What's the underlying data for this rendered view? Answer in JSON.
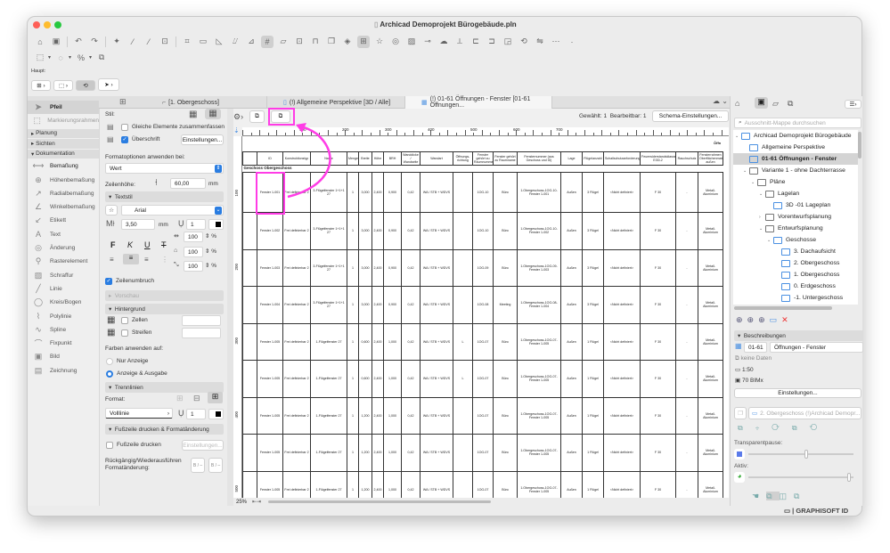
{
  "window": {
    "title": "Archicad Demoprojekt Bürogebäude.pln"
  },
  "toolbar": {
    "label": "Haupt:",
    "icons": [
      "home-icon",
      "save-icon",
      "undo-icon",
      "redo-icon",
      "magic-wand-icon",
      "eyedropper-icon",
      "syringe-icon",
      "group-icon",
      "fit-icon",
      "table-icon",
      "triangle-icon",
      "guide-icon",
      "snap-icon",
      "grid-icon",
      "plane-icon",
      "select-frame-icon",
      "lock-icon",
      "layer-icon",
      "cube-icon",
      "grid-snap-icon",
      "favorite-icon",
      "graphic-override-icon",
      "image-icon",
      "link-icon",
      "cloud-icon",
      "measure-icon",
      "dimension-icon",
      "section-icon",
      "elevation-icon",
      "element-icon",
      "rotate-icon",
      "mirror-icon",
      "more-icon"
    ]
  },
  "tabs": [
    {
      "label": "[1. Obergeschoss]"
    },
    {
      "label": "(!) Allgemeine Perspektive [3D / Alle]"
    },
    {
      "label": "(!) 01-61 Öffnungen - Fenster [01-61 Öffnungen..."
    }
  ],
  "toolbox": {
    "tools_top": [
      {
        "label": "Pfeil",
        "icon": "arrow-icon"
      },
      {
        "label": "Markierungsrahmen",
        "icon": "marquee-icon"
      }
    ],
    "groups": [
      "Planung",
      "Sichten",
      "Dokumentation"
    ],
    "tools": [
      {
        "label": "Bemaßung",
        "icon": "⟷"
      },
      {
        "label": "Höhenbemaßung",
        "icon": "⊕"
      },
      {
        "label": "Radialbemaßung",
        "icon": "↗"
      },
      {
        "label": "Winkelbemaßung",
        "icon": "∠"
      },
      {
        "label": "Etikett",
        "icon": "↙"
      },
      {
        "label": "Text",
        "icon": "A"
      },
      {
        "label": "Änderung",
        "icon": "◎"
      },
      {
        "label": "Rasterelement",
        "icon": "⚲"
      },
      {
        "label": "Schraffur",
        "icon": "▨"
      },
      {
        "label": "Linie",
        "icon": "╱"
      },
      {
        "label": "Kreis/Bogen",
        "icon": "◯"
      },
      {
        "label": "Polylinie",
        "icon": "⌇"
      },
      {
        "label": "Spline",
        "icon": "∿"
      },
      {
        "label": "Fixpunkt",
        "icon": "⌒"
      },
      {
        "label": "Bild",
        "icon": "▣"
      },
      {
        "label": "Zeichnung",
        "icon": "▤"
      }
    ]
  },
  "settings": {
    "stil": "Stil:",
    "merge": "Gleiche Elemente zusammenfassen",
    "header": "Überschrift",
    "einstellungen": "Einstellungen...",
    "format_apply": "Formatoptionen anwenden bei:",
    "format_value": "Wert",
    "row_height_label": "Zeilenhöhe:",
    "row_height": "60,00",
    "mm": "mm",
    "textstil": "Textstil",
    "font": "Arial",
    "font_size": "3,50",
    "pen": "1",
    "bold": "F",
    "italic": "K",
    "underline": "U",
    "strike": "T",
    "scale1": "100",
    "scale2": "100",
    "scale3": "100",
    "pct": "%",
    "wrap": "Zeilenumbruch",
    "preview": "Vorschau",
    "background": "Hintergrund",
    "cells": "Zellen",
    "stripes": "Streifen",
    "apply_colors": "Farben anwenden auf:",
    "only_display": "Nur Anzeige",
    "display_output": "Anzeige & Ausgabe",
    "lines": "Trennlinien",
    "format": "Format:",
    "line_type": "Volllinie",
    "line_pen": "1",
    "footer_section": "Fußzeile drucken & Formatänderung",
    "footer_print": "Fußzeile drucken",
    "footer_settings": "Einstellungen...",
    "undo_label": "Rückgängig/Wiederausführen Formatänderung:",
    "undo_btn": "B / –",
    "redo_btn": "B / –"
  },
  "schedule": {
    "selected": "Gewählt: 1",
    "editable": "Bearbeitbar: 1",
    "schema_btn": "Schema-Einstellungen...",
    "ruler": [
      "100",
      "200",
      "300",
      "400",
      "500",
      "600",
      "700"
    ],
    "vruler": [
      "100",
      "200",
      "300",
      "400",
      "500"
    ],
    "title_right": "Öffn",
    "zoom": "25%",
    "group_label": "Geschoss  Obergeschoss",
    "columns": [
      "ID",
      "Konstruktionstyp",
      "Name",
      "Menge",
      "Breite",
      "Höhe",
      "BRH",
      "Wanddicke / Wandseite",
      "Wandart",
      "Öffnungs-richtung",
      "Fenster gehört zu Raumnummer",
      "Fenster gehört zu Raumname",
      "Fensternummer (aus Geschoss und ID)",
      "Lage",
      "Flügelanzahl",
      "Schallschutzanforderung",
      "Feuerwiderstandsklasse EI30-2",
      "Rauchschutz",
      "Fensterrahmen Oberflächenmaterial außen"
    ],
    "rows": [
      [
        "Fenster 1-001",
        "Frei definierbar 2",
        "3-Flügelfenster 1+1+1 27",
        "1",
        "3,000",
        "2,400",
        "0,900",
        "0,42",
        "WA / STB + WDVS",
        "",
        "1OG-10",
        "Büro",
        "1.Obergeschoss-1OG-10-Fenster 1-001",
        "Außen",
        "3 Flügel",
        "<Nicht definiert>",
        "F 30",
        "-",
        "Metall-Aluminium"
      ],
      [
        "Fenster 1-002",
        "Frei definierbar 2",
        "3-Flügelfenster 1+1+1 27",
        "1",
        "3,000",
        "2,400",
        "0,900",
        "0,42",
        "WA / STB + WDVS",
        "",
        "1OG-10",
        "Büro",
        "1.Obergeschoss-1OG-10-Fenster 1-002",
        "Außen",
        "3 Flügel",
        "<Nicht definiert>",
        "F 30",
        "-",
        "Metall-Aluminium"
      ],
      [
        "Fenster 1-003",
        "Frei definierbar 2",
        "3-Flügelfenster 1+1+1 27",
        "1",
        "3,000",
        "2,400",
        "0,900",
        "0,42",
        "WA / STB + WDVS",
        "",
        "1OG-09",
        "Büro",
        "1.Obergeschoss-1OG-09-Fenster 1-003",
        "Außen",
        "3 Flügel",
        "<Nicht definiert>",
        "F 30",
        "-",
        "Metall-Aluminium"
      ],
      [
        "Fenster 1-004",
        "Frei definierbar 2",
        "3-Flügelfenster 1+1+1 27",
        "1",
        "3,000",
        "2,400",
        "0,900",
        "0,42",
        "WA / STB + WDVS",
        "",
        "1OG-08",
        "Meeting",
        "1.Obergeschoss-1OG-08-Fenster 1-004",
        "Außen",
        "3 Flügel",
        "<Nicht definiert>",
        "F 30",
        "-",
        "Metall-Aluminium"
      ],
      [
        "Fenster 1-005",
        "Frei definierbar 2",
        "1-Flügelfenster 27",
        "1",
        "0,600",
        "2,400",
        "1,000",
        "0,42",
        "WA / STB + WDVS",
        "L",
        "1OG-07",
        "Büro",
        "1.Obergeschoss-1OG-07-Fenster 1-005",
        "Außen",
        "1 Flügel",
        "<Nicht definiert>",
        "F 30",
        "-",
        "Metall-Aluminium"
      ],
      [
        "Fenster 1-005",
        "Frei definierbar 2",
        "1-Flügelfenster 27",
        "1",
        "0,600",
        "2,400",
        "1,000",
        "0,42",
        "WA / STB + WDVS",
        "L",
        "1OG-07",
        "Büro",
        "1.Obergeschoss-1OG-07-Fenster 1-005",
        "Außen",
        "1 Flügel",
        "<Nicht definiert>",
        "F 30",
        "-",
        "Metall-Aluminium"
      ],
      [
        "Fenster 1-005",
        "Frei definierbar 2",
        "1-Flügelfenster 27",
        "1",
        "1,200",
        "2,400",
        "1,000",
        "0,42",
        "WA / STB + WDVS",
        "",
        "1OG-07",
        "Büro",
        "1.Obergeschoss-1OG-07-Fenster 1-005",
        "Außen",
        "1 Flügel",
        "<Nicht definiert>",
        "F 30",
        "-",
        "Metall-Aluminium"
      ],
      [
        "Fenster 1-005",
        "Frei definierbar 2",
        "1-Flügelfenster 27",
        "1",
        "1,200",
        "2,400",
        "1,000",
        "0,42",
        "WA / STB + WDVS",
        "",
        "1OG-07",
        "Büro",
        "1.Obergeschoss-1OG-07-Fenster 1-005",
        "Außen",
        "1 Flügel",
        "<Nicht definiert>",
        "F 30",
        "-",
        "Metall-Aluminium"
      ],
      [
        "Fenster 1-005",
        "Frei definierbar 2",
        "1-Flügelfenster 27",
        "1",
        "1,200",
        "2,400",
        "1,000",
        "0,42",
        "WA / STB + WDVS",
        "",
        "1OG-07",
        "Büro",
        "1.Obergeschoss-1OG-07-Fenster 1-005",
        "Außen",
        "1 Flügel",
        "<Nicht definiert>",
        "F 30",
        "-",
        "Metall-Aluminium"
      ]
    ]
  },
  "navigator": {
    "search_placeholder": "Ausschnitt-Mappe durchsuchen",
    "tree": [
      {
        "label": "Archicad Demoprojekt Bürogebäude",
        "level": 0,
        "arrow": "v",
        "icon": "project-icon"
      },
      {
        "label": "Allgemeine Perspektive",
        "level": 1,
        "arrow": "",
        "icon": "perspective-icon"
      },
      {
        "label": "01-61 Öffnungen - Fenster",
        "level": 1,
        "arrow": "",
        "icon": "schedule-icon",
        "selected": true
      },
      {
        "label": "Variante 1 - ohne Dachterrasse",
        "level": 1,
        "arrow": "v",
        "icon": "folder-icon"
      },
      {
        "label": "Pläne",
        "level": 2,
        "arrow": "v",
        "icon": "folder-icon"
      },
      {
        "label": "Lagelan",
        "level": 3,
        "arrow": "v",
        "icon": "folder-icon"
      },
      {
        "label": "3D -01 Lageplan",
        "level": 4,
        "arrow": "",
        "icon": "view-icon"
      },
      {
        "label": "Vorentwurfsplanung",
        "level": 3,
        "arrow": ">",
        "icon": "folder-icon"
      },
      {
        "label": "Entwurfsplanung",
        "level": 3,
        "arrow": "v",
        "icon": "folder-icon"
      },
      {
        "label": "Geschosse",
        "level": 4,
        "arrow": "v",
        "icon": "story-folder-icon"
      },
      {
        "label": "3. Dachaufsicht",
        "level": 5,
        "arrow": "",
        "icon": "story-icon"
      },
      {
        "label": "2. Obergeschoss",
        "level": 5,
        "arrow": "",
        "icon": "story-icon"
      },
      {
        "label": "1. Obergeschoss",
        "level": 5,
        "arrow": "",
        "icon": "story-icon"
      },
      {
        "label": "0. Erdgeschoss",
        "level": 5,
        "arrow": "",
        "icon": "story-icon"
      },
      {
        "label": "-1. Untergeschoss",
        "level": 5,
        "arrow": "",
        "icon": "story-icon"
      }
    ],
    "descriptions": "Beschreibungen",
    "id": "01-61",
    "name": "Öffnungen - Fenster",
    "no_data": "keine Daten",
    "scale": "1:50",
    "pen_set": "70 BIMx",
    "settings_btn": "Einstellungen...",
    "trace_ref": "2. Obergeschoss (!)Archicad Demopr...",
    "trace_label": "Transparentpause:",
    "active_label": "Aktiv:",
    "trace_level": 0.55,
    "active_level": 0.97
  },
  "statusbar": {
    "graphisoft": "GRAPHISOFT ID"
  },
  "annotation_color": "#ff3ce6"
}
